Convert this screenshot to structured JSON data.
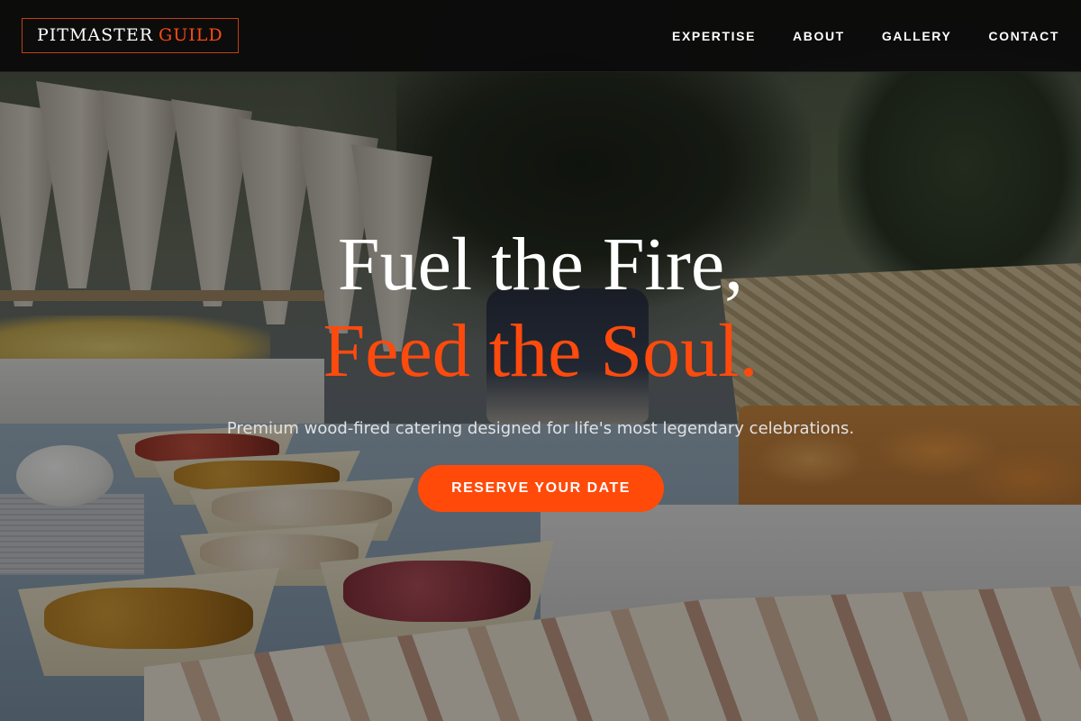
{
  "brand": {
    "name_primary": "PITMASTER",
    "name_accent": "GUILD",
    "accent_color": "#ff4a0d"
  },
  "nav": {
    "links": [
      {
        "label": "EXPERTISE"
      },
      {
        "label": "ABOUT"
      },
      {
        "label": "GALLERY"
      },
      {
        "label": "CONTACT"
      }
    ]
  },
  "hero": {
    "headline_line1": "Fuel the Fire,",
    "headline_line2": "Feed the Soul.",
    "subtitle": "Premium wood-fired catering designed for life's most legendary celebrations.",
    "cta_label": "RESERVE YOUR DATE",
    "background_image": "catering-spread-photo"
  }
}
